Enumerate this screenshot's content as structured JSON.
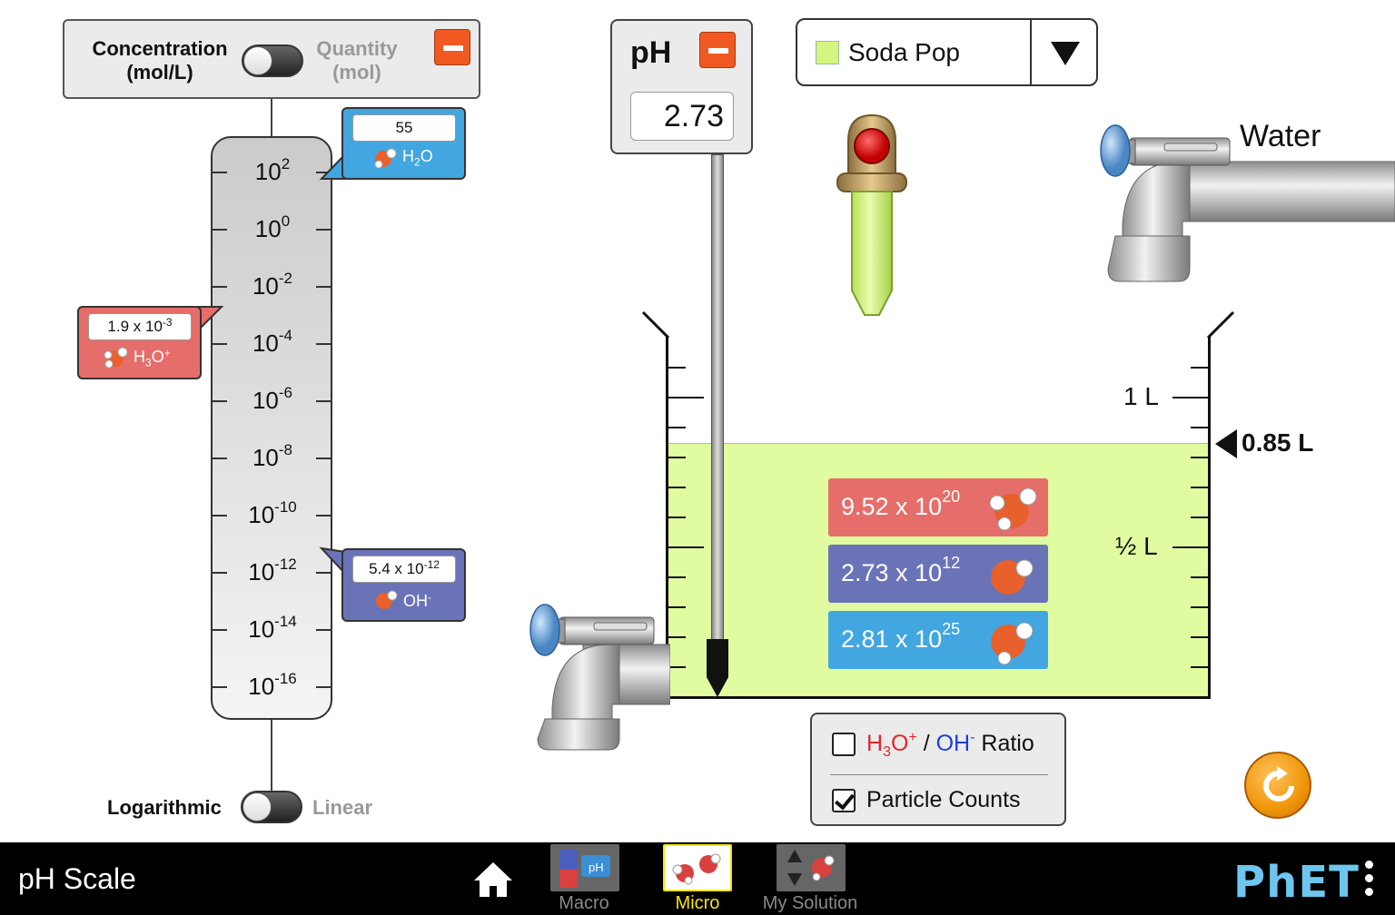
{
  "graph": {
    "toggle_concentration_line1": "Concentration",
    "toggle_concentration_line2": "(mol/L)",
    "toggle_quantity_line1": "Quantity",
    "toggle_quantity_line2": "(mol)",
    "scale_mode_left": "Logarithmic",
    "scale_mode_right": "Linear",
    "tick_bases": [
      "10",
      "10",
      "10",
      "10",
      "10",
      "10",
      "10",
      "10",
      "10",
      "10"
    ],
    "tick_exponents": [
      "2",
      "0",
      "-2",
      "-4",
      "-6",
      "-8",
      "-10",
      "-12",
      "-14",
      "-16"
    ],
    "h2o": {
      "value": "55",
      "species": "H",
      "sub": "2",
      "tail": "O",
      "color": "#42a6e0"
    },
    "h3o": {
      "mantissa": "1.9 x 10",
      "exponent": "-3",
      "species": "H",
      "sub": "3",
      "tail": "O",
      "sup": "+",
      "color": "#e56d6a"
    },
    "oh": {
      "mantissa": "5.4 x 10",
      "exponent": "-12",
      "species": "OH",
      "sup": "-",
      "color": "#6b73b8"
    }
  },
  "ph_meter": {
    "title": "pH",
    "value": "2.73"
  },
  "solute": {
    "selected": "Soda Pop",
    "swatch_color": "#d4f57f"
  },
  "water_faucet": {
    "label": "Water"
  },
  "beaker": {
    "label_1l": "1 L",
    "label_half": "½ L",
    "volume": "0.85 L"
  },
  "particle_counts": [
    {
      "mantissa": "9.52 x 10",
      "exponent": "20",
      "color": "#e56d6a"
    },
    {
      "mantissa": "2.73 x 10",
      "exponent": "12",
      "color": "#6b73b8"
    },
    {
      "mantissa": "2.81 x 10",
      "exponent": "25",
      "color": "#42a6e0"
    }
  ],
  "options": {
    "ratio": {
      "h": "H",
      "sub": "3",
      "o": "O",
      "plus": "+",
      "slash": " / ",
      "oh": "OH",
      "minus": "-",
      "rest": " Ratio",
      "checked": false
    },
    "particle_counts": {
      "label": "Particle Counts",
      "checked": true
    }
  },
  "navbar": {
    "title": "pH Scale",
    "screens": [
      "Macro",
      "Micro",
      "My Solution"
    ],
    "macro_icon_text": "pH",
    "active_screen": "Micro",
    "active_color": "#f5e50a",
    "inactive_color": "#8a8a8a",
    "brand": "PhET"
  }
}
